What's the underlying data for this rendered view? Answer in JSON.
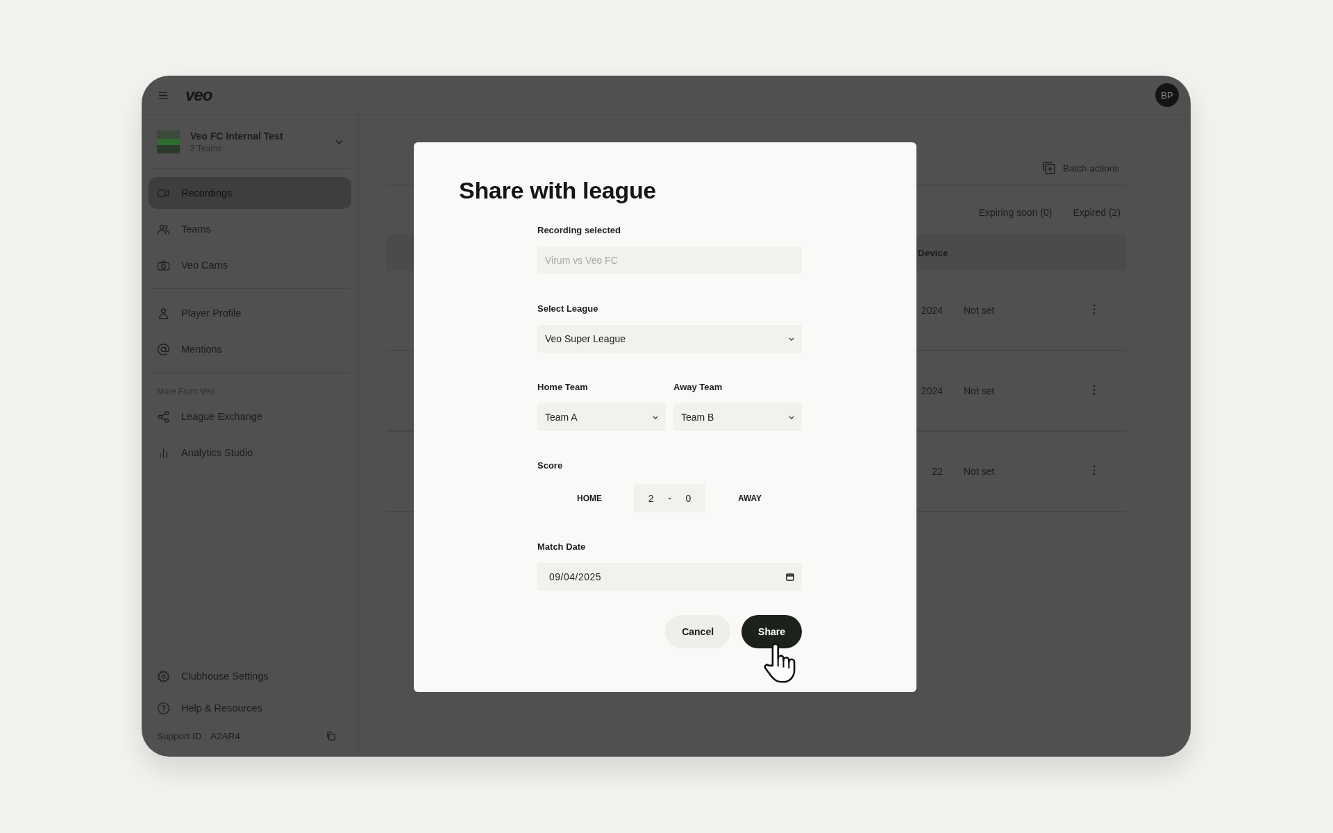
{
  "topbar": {
    "logo": "veo",
    "avatar": "BP"
  },
  "sidebar": {
    "org": {
      "name": "Veo FC Internal Test",
      "subtitle": "2 Teams"
    },
    "groups": [
      {
        "items": [
          {
            "label": "Recordings",
            "selected": true
          },
          {
            "label": "Teams",
            "selected": false
          },
          {
            "label": "Veo Cams",
            "selected": false
          }
        ]
      },
      {
        "items": [
          {
            "label": "Player Profile",
            "selected": false
          },
          {
            "label": "Mentions",
            "selected": false
          }
        ]
      },
      {
        "heading": "More From Veo",
        "items": [
          {
            "label": "League Exchange",
            "selected": false
          },
          {
            "label": "Analytics Studio",
            "selected": false
          }
        ]
      }
    ],
    "footer_items": [
      {
        "label": "Clubhouse Settings",
        "selected": false
      },
      {
        "label": "Help & Resources",
        "selected": false
      }
    ],
    "support": {
      "label": "Support ID :",
      "value": "A2AR4"
    }
  },
  "main": {
    "batch_action": "Batch actions",
    "filters": [
      "Expiring soon (0)",
      "Expired (2)"
    ],
    "table": {
      "columns": [
        "Device"
      ],
      "rows": [
        {
          "column_1": "2024",
          "device": "Not set"
        },
        {
          "column_1": "2024",
          "device": "Not set"
        },
        {
          "column_1": "22",
          "device": "Not set"
        }
      ]
    }
  },
  "dialog": {
    "title": "Share with league",
    "recording": {
      "label": "Recording selected",
      "placeholder": "Virum vs Veo FC"
    },
    "league": {
      "label": "Select League",
      "value": "Veo Super League"
    },
    "home_team": {
      "label": "Home Team",
      "value": "Team A"
    },
    "away_team": {
      "label": "Away Team",
      "value": "Team B"
    },
    "score": {
      "label": "Score",
      "home_label": "HOME",
      "home": "2",
      "separator": "-",
      "away": "0",
      "away_label": "AWAY"
    },
    "match_date": {
      "label": "Match Date",
      "value": "09/04/2025"
    },
    "buttons": [
      {
        "label": "Cancel",
        "kind": "secondary"
      },
      {
        "label": "Share",
        "kind": "primary"
      }
    ]
  }
}
